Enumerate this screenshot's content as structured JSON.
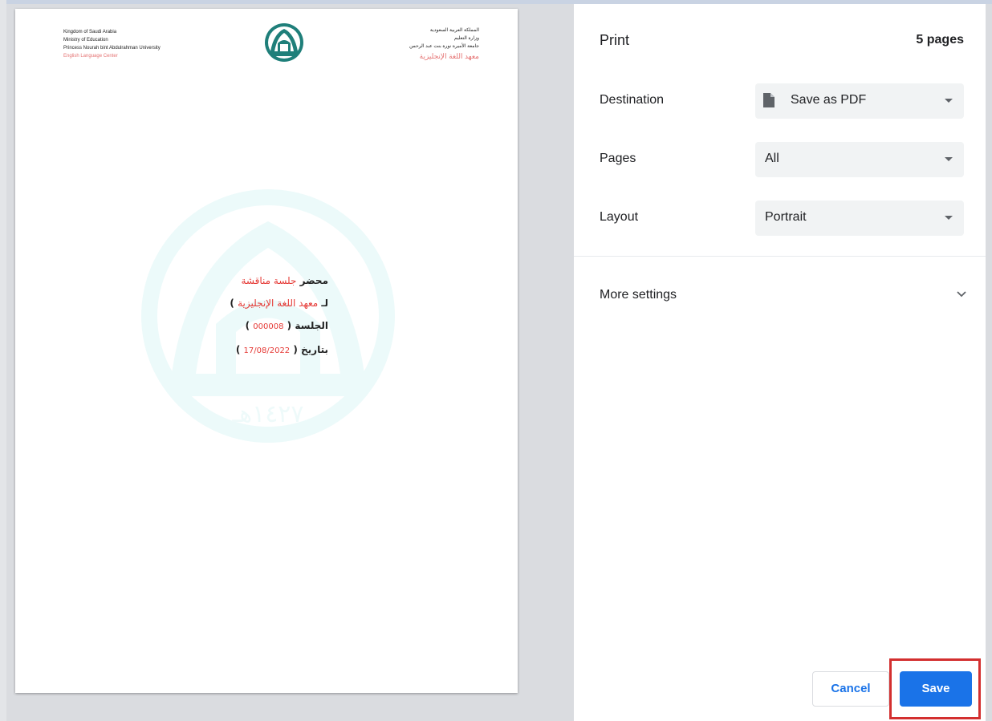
{
  "print_panel": {
    "title": "Print",
    "page_count": "5 pages",
    "destination": {
      "label": "Destination",
      "value": "Save as PDF"
    },
    "pages": {
      "label": "Pages",
      "value": "All"
    },
    "layout": {
      "label": "Layout",
      "value": "Portrait"
    },
    "more_settings": "More settings",
    "cancel_label": "Cancel",
    "save_label": "Save"
  },
  "preview": {
    "header_left": [
      "Kingdom of Saudi Arabia",
      "Ministry of Education",
      "Princess Nourah bint Abdulrahman University",
      "English Language Center"
    ],
    "header_right": [
      "المملكة العربية السعودية",
      "وزارة التعليم",
      "جامعة الأميرة نورة بنت عبد الرحمن",
      "معهد اللغة الإنجليزية"
    ],
    "body": {
      "line1_black": "محضر",
      "line1_red": "جلسة مناقشة",
      "line2_black": "لـ",
      "line2_red": "معهد اللغة الإنجليزية",
      "line2_close": ")",
      "line3_black": "الجلسة (",
      "line3_red": "000008",
      "line3_close": ")",
      "line4_black": "بتاريخ (",
      "line4_red": "17/08/2022",
      "line4_close": ")"
    },
    "watermark_text": "١٤٢٧هـ"
  },
  "colors": {
    "accent": "#1a73e8",
    "highlight": "#d32f2f",
    "document_red": "#e53935",
    "logo_teal": "#1f7f7a"
  }
}
